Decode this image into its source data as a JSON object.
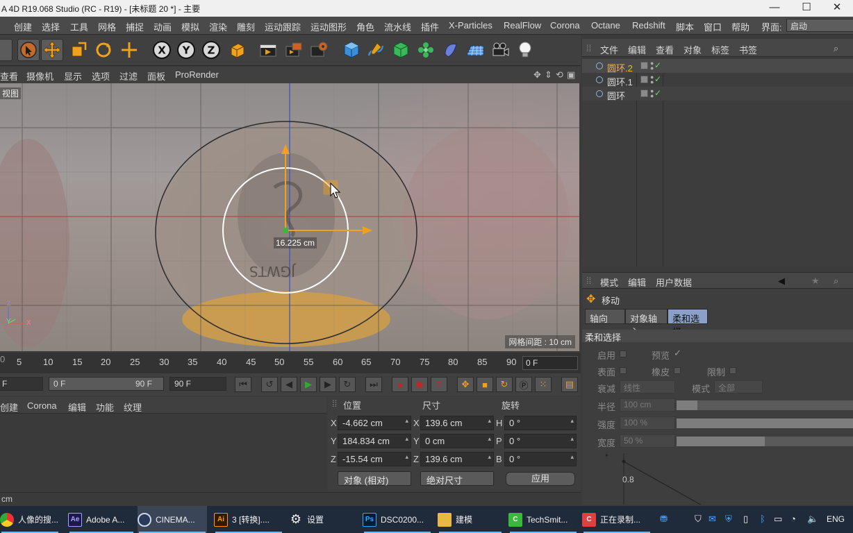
{
  "window": {
    "title": "A 4D R19.068 Studio (RC - R19) - [未标题 20 *] - 主要",
    "minimize": "—",
    "maximize": "☐"
  },
  "menubar": {
    "items": [
      "创建",
      "选择",
      "工具",
      "网格",
      "捕捉",
      "动画",
      "模拟",
      "渲染",
      "雕刻",
      "运动跟踪",
      "运动图形",
      "角色",
      "流水线",
      "插件",
      "X-Particles",
      "RealFlow",
      "Corona",
      "Octane",
      "Redshift",
      "脚本",
      "窗口",
      "帮助"
    ],
    "layout_label": "界面:",
    "layout_value": "启动"
  },
  "viewport_menu": {
    "items": [
      "查看",
      "摄像机",
      "显示",
      "选项",
      "过滤",
      "面板",
      "ProRender"
    ]
  },
  "viewport": {
    "label": "视图",
    "measure": "16.225 cm",
    "grid_spacing": "网格间距 : 10 cm",
    "axis_y": "Y",
    "axis_x": "X",
    "axis_z": "Z"
  },
  "timeline": {
    "ticks": [
      "5",
      "10",
      "15",
      "20",
      "25",
      "30",
      "35",
      "40",
      "45",
      "50",
      "55",
      "60",
      "65",
      "70",
      "75",
      "80",
      "85",
      "90"
    ],
    "current_frame": "0 F"
  },
  "transport": {
    "start": "F",
    "range_start": "0 F",
    "range_end": "90 F",
    "end": "90 F"
  },
  "material_menu": {
    "items": [
      "创建",
      "Corona",
      "编辑",
      "功能",
      "纹理"
    ]
  },
  "coordinates": {
    "headers": [
      "位置",
      "尺寸",
      "旋转"
    ],
    "position": [
      {
        "axis": "X",
        "value": "-4.662 cm"
      },
      {
        "axis": "Y",
        "value": "184.834 cm"
      },
      {
        "axis": "Z",
        "value": "-15.54 cm"
      }
    ],
    "size": [
      {
        "axis": "X",
        "value": "139.6 cm"
      },
      {
        "axis": "Y",
        "value": "0 cm"
      },
      {
        "axis": "Z",
        "value": "139.6 cm"
      }
    ],
    "rotation": [
      {
        "axis": "H",
        "value": "0 °"
      },
      {
        "axis": "P",
        "value": "0 °"
      },
      {
        "axis": "B",
        "value": "0 °"
      }
    ],
    "mode": "对象 (相对)",
    "size_mode": "绝对尺寸",
    "apply": "应用"
  },
  "status": {
    "text": "cm"
  },
  "object_manager": {
    "menu": [
      "文件",
      "编辑",
      "查看",
      "对象",
      "标签",
      "书签"
    ],
    "objects": [
      {
        "name": "圆环.2",
        "selected": true
      },
      {
        "name": "圆环.1",
        "selected": false
      },
      {
        "name": "圆环",
        "selected": false
      }
    ]
  },
  "attribute_manager": {
    "menu": [
      "模式",
      "编辑",
      "用户数据"
    ],
    "tool_name": "移动",
    "tabs": [
      "轴向",
      "对象轴心",
      "柔和选择"
    ],
    "active_tab": "柔和选择",
    "section": "柔和选择",
    "enable": "启用",
    "preview": "预览",
    "surface": "表面",
    "rubber": "橡皮",
    "limit": "限制",
    "falloff_label": "衰减",
    "falloff_value": "线性",
    "mode_label": "模式",
    "mode_value": "全部",
    "radius_label": "半径",
    "radius_value": "100 cm",
    "radius_fill": 0.12,
    "strength_label": "强度",
    "strength_value": "100 %",
    "strength_fill": 1.0,
    "width_label": "宽度",
    "width_value": "50 %",
    "width_fill": 0.5,
    "graph_value": "0.8"
  },
  "taskbar": {
    "tasks": [
      {
        "name": "人像的搜...",
        "icon": "chrome-icon"
      },
      {
        "name": "Adobe A...",
        "icon": "ae-icon"
      },
      {
        "name": "CINEMA...",
        "icon": "c4d-icon"
      },
      {
        "name": "3 [转换]....",
        "icon": "ai-icon"
      },
      {
        "name": "设置",
        "icon": "gear-icon"
      },
      {
        "name": "DSC0200...",
        "icon": "ps-icon"
      },
      {
        "name": "建模",
        "icon": "folder-icon"
      },
      {
        "name": "TechSmit...",
        "icon": "techsmith-icon"
      },
      {
        "name": "正在录制...",
        "icon": "camtasia-icon"
      }
    ],
    "lang": "ENG"
  },
  "colors": {
    "accent_selected": "#f2b13a",
    "active_tab": "#8aa0c8",
    "taskbar": "#1f2a3a"
  }
}
